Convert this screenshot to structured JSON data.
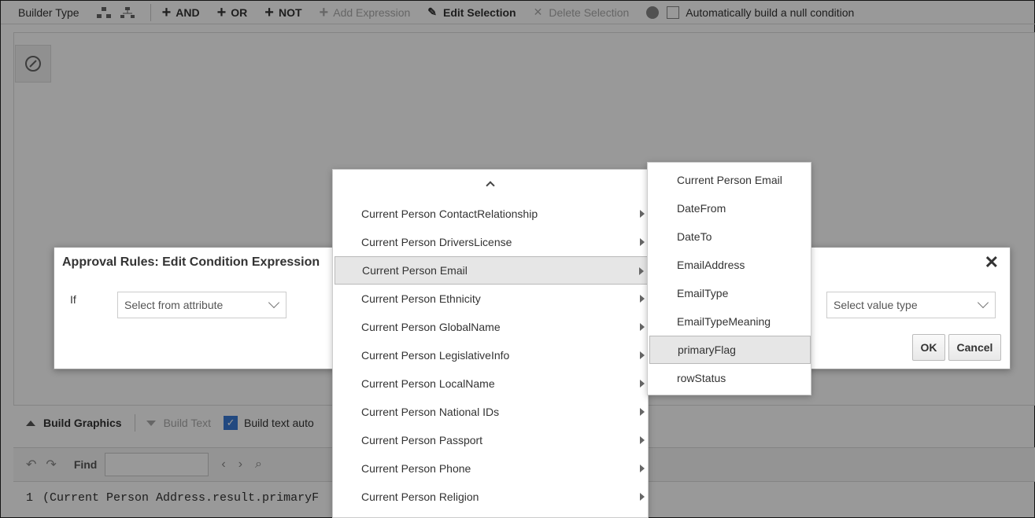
{
  "toolbar": {
    "builder_type": "Builder Type",
    "and_label": "AND",
    "or_label": "OR",
    "not_label": "NOT",
    "add_expression": "Add Expression",
    "edit_selection": "Edit Selection",
    "delete_selection": "Delete Selection",
    "null_condition": "Automatically build a null condition"
  },
  "build_bar": {
    "build_graphics": "Build Graphics",
    "build_text": "Build Text",
    "build_text_auto": "Build text auto"
  },
  "find_bar": {
    "find_label": "Find"
  },
  "editor": {
    "line_number": "1",
    "line_text": "(Current Person Address.result.primaryF"
  },
  "dialog": {
    "title": "Approval Rules: Edit Condition Expression",
    "close_glyph": "✕",
    "if_label": "If",
    "attribute_select": "Select from attribute",
    "value_type_select": "Select value type",
    "ok_label": "OK",
    "cancel_label": "Cancel"
  },
  "attribute_menu": {
    "items": [
      {
        "label": "Current Person ContactRelationship"
      },
      {
        "label": "Current Person DriversLicense"
      },
      {
        "label": "Current Person Email"
      },
      {
        "label": "Current Person Ethnicity"
      },
      {
        "label": "Current Person GlobalName"
      },
      {
        "label": "Current Person LegislativeInfo"
      },
      {
        "label": "Current Person LocalName"
      },
      {
        "label": "Current Person National IDs"
      },
      {
        "label": "Current Person Passport"
      },
      {
        "label": "Current Person Phone"
      },
      {
        "label": "Current Person Religion"
      }
    ],
    "selected_item": "Current Person Email"
  },
  "email_submenu": {
    "items": [
      {
        "label": "Current Person Email"
      },
      {
        "label": "DateFrom"
      },
      {
        "label": "DateTo"
      },
      {
        "label": "EmailAddress"
      },
      {
        "label": "EmailType"
      },
      {
        "label": "EmailTypeMeaning"
      },
      {
        "label": "primaryFlag"
      },
      {
        "label": "rowStatus"
      }
    ],
    "selected_item": "primaryFlag"
  },
  "colors": {
    "overlay": "#666666",
    "selected_row": "#e6e6e6",
    "checkbox_accent": "#3a7bd5"
  }
}
